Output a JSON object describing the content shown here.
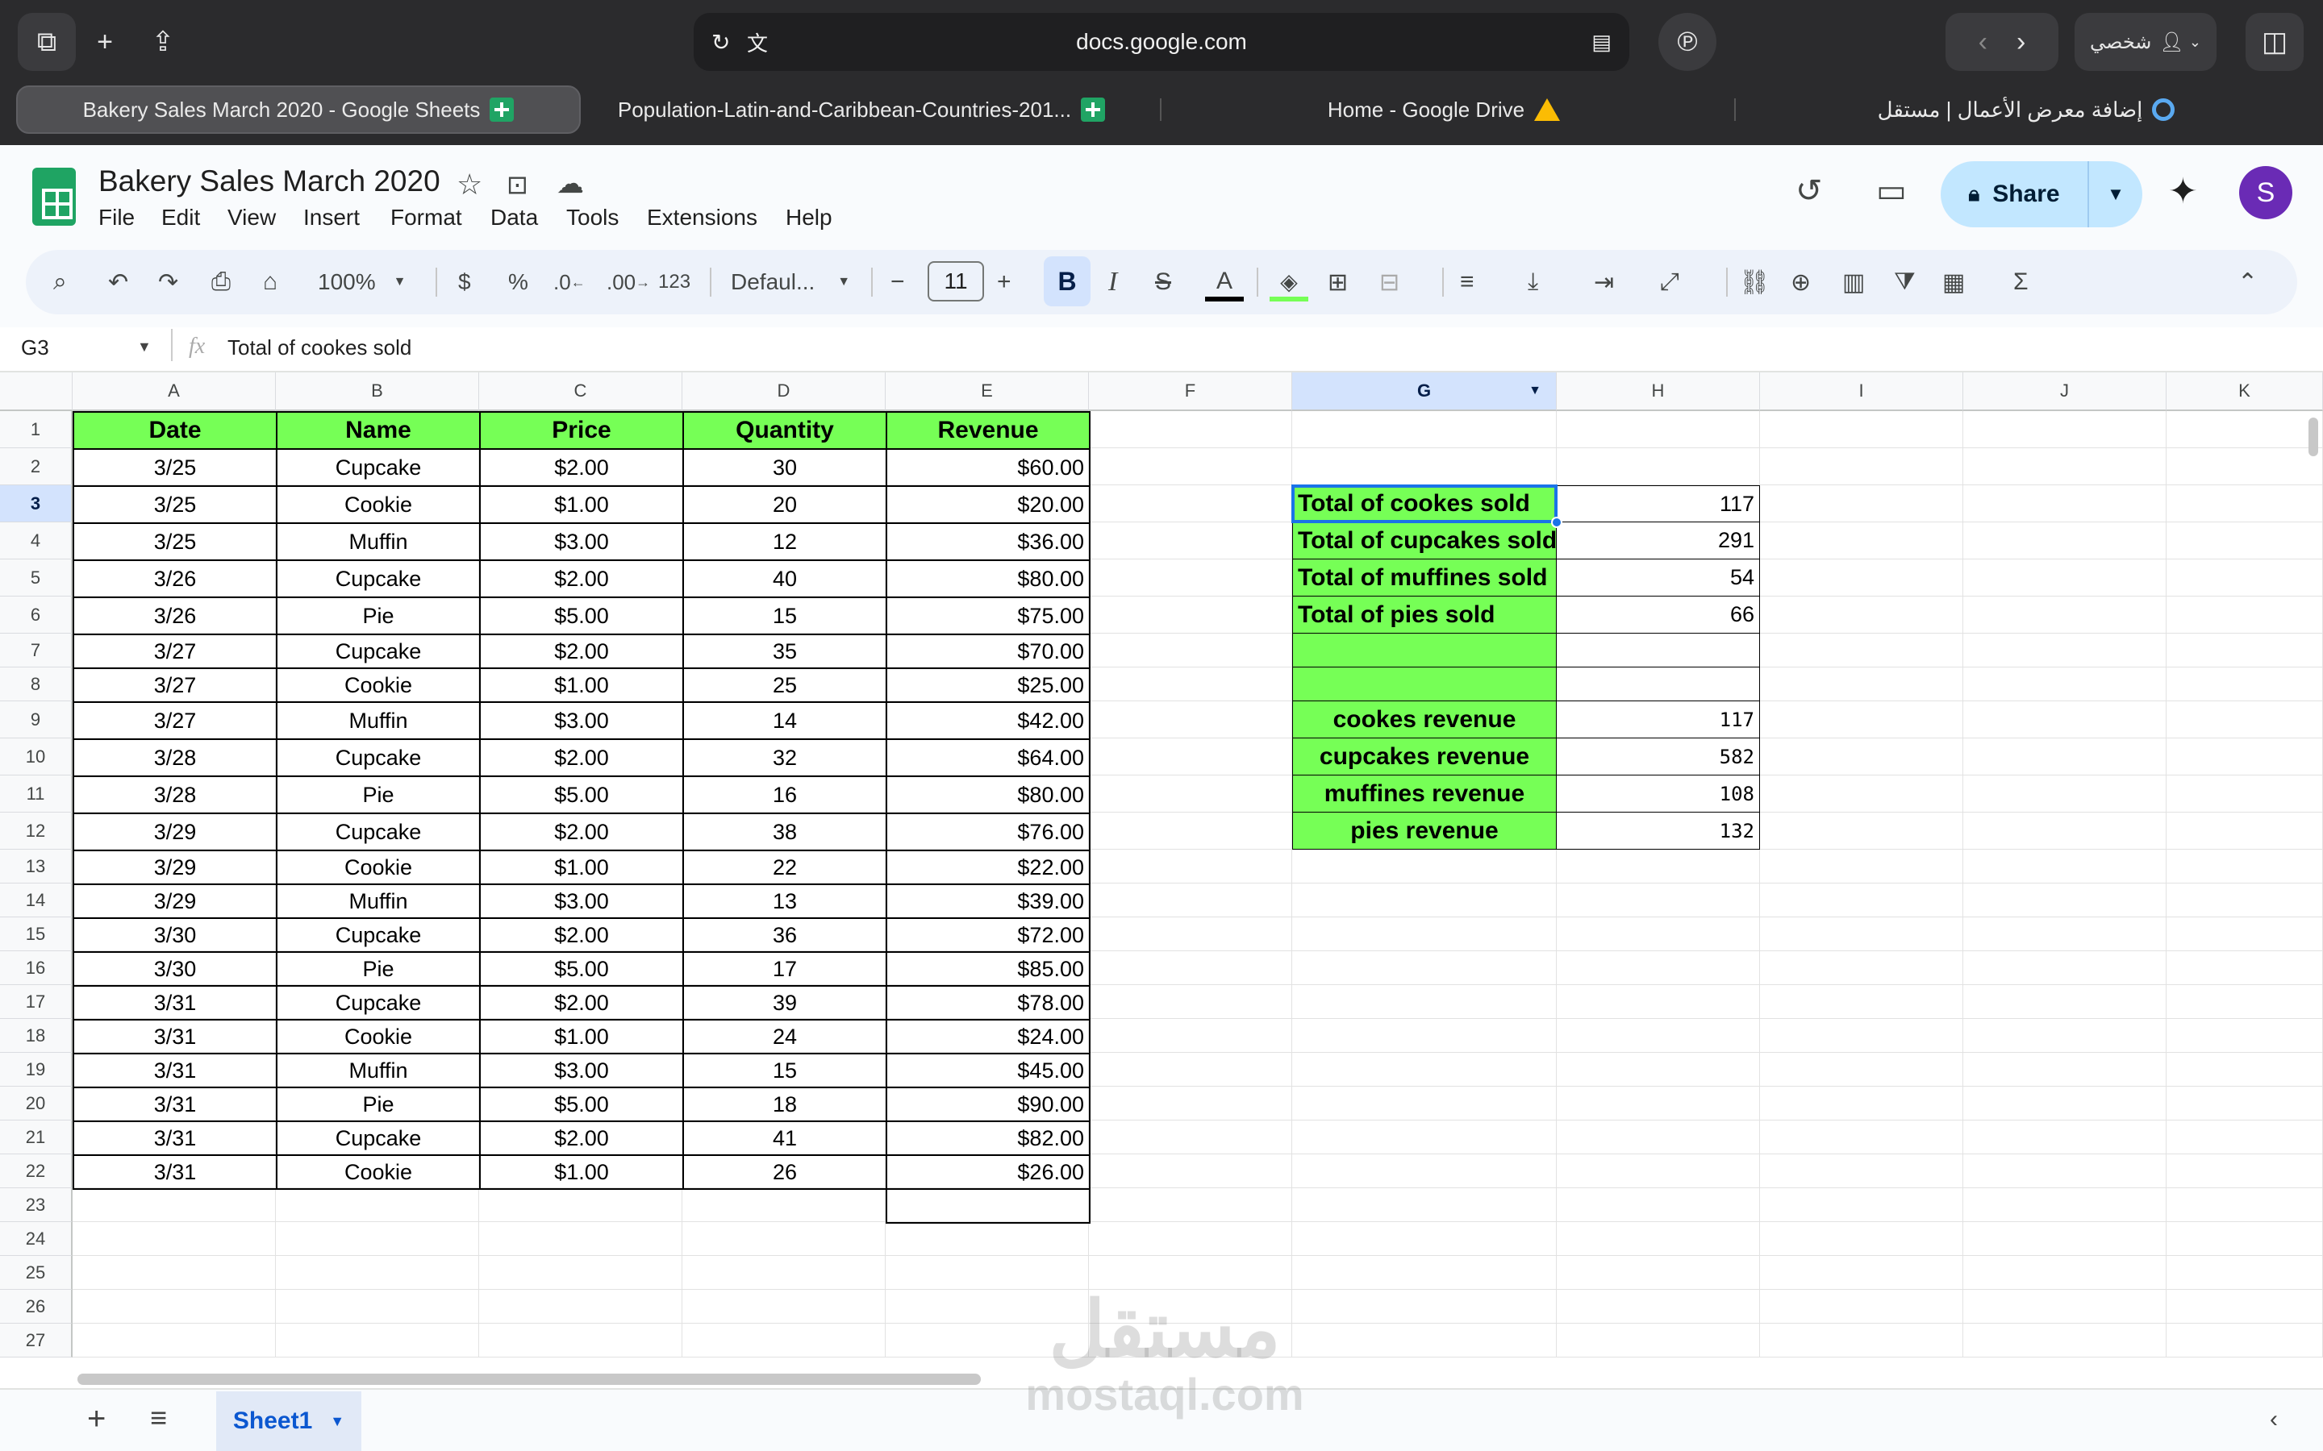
{
  "browser": {
    "url": "docs.google.com",
    "profile_label": "شخصي",
    "tabs": [
      {
        "label": "Bakery Sales March 2020 - Google Sheets",
        "icon": "sheets-icon"
      },
      {
        "label": "Population-Latin-and-Caribbean-Countries-201...",
        "icon": "sheets-icon"
      },
      {
        "label": "Home - Google Drive",
        "icon": "drive-icon"
      },
      {
        "label": "إضافة معرض الأعمال | مستقل",
        "icon": "globe-icon"
      }
    ]
  },
  "doc": {
    "title": "Bakery Sales March 2020",
    "menu": [
      "File",
      "Edit",
      "View",
      "Insert",
      "Format",
      "Data",
      "Tools",
      "Extensions",
      "Help"
    ],
    "share_label": "Share",
    "avatar_letter": "S"
  },
  "toolbar": {
    "zoom": "100%",
    "currency": "$",
    "percent": "%",
    "dec_decrease": ".0",
    "dec_increase": ".00",
    "number_format": "123",
    "font": "Defaul...",
    "font_size": "11",
    "bold": "B",
    "italic": "I",
    "text_color": "A"
  },
  "formula_bar": {
    "cell_ref": "G3",
    "fx": "fx",
    "content": "Total of cookes sold"
  },
  "columns": [
    "A",
    "B",
    "C",
    "D",
    "E",
    "F",
    "G",
    "H",
    "I",
    "J",
    "K"
  ],
  "rows": [
    "1",
    "2",
    "3",
    "4",
    "5",
    "6",
    "7",
    "8",
    "9",
    "10",
    "11",
    "12",
    "13",
    "14",
    "15",
    "16",
    "17",
    "18",
    "19",
    "20",
    "21",
    "22",
    "23",
    "24",
    "25",
    "26",
    "27"
  ],
  "table": {
    "headers": [
      "Date",
      "Name",
      "Price",
      "Quantity",
      "Revenue"
    ],
    "rows": [
      [
        "3/25",
        "Cupcake",
        "$2.00",
        "30",
        "$60.00"
      ],
      [
        "3/25",
        "Cookie",
        "$1.00",
        "20",
        "$20.00"
      ],
      [
        "3/25",
        "Muffin",
        "$3.00",
        "12",
        "$36.00"
      ],
      [
        "3/26",
        "Cupcake",
        "$2.00",
        "40",
        "$80.00"
      ],
      [
        "3/26",
        "Pie",
        "$5.00",
        "15",
        "$75.00"
      ],
      [
        "3/27",
        "Cupcake",
        "$2.00",
        "35",
        "$70.00"
      ],
      [
        "3/27",
        "Cookie",
        "$1.00",
        "25",
        "$25.00"
      ],
      [
        "3/27",
        "Muffin",
        "$3.00",
        "14",
        "$42.00"
      ],
      [
        "3/28",
        "Cupcake",
        "$2.00",
        "32",
        "$64.00"
      ],
      [
        "3/28",
        "Pie",
        "$5.00",
        "16",
        "$80.00"
      ],
      [
        "3/29",
        "Cupcake",
        "$2.00",
        "38",
        "$76.00"
      ],
      [
        "3/29",
        "Cookie",
        "$1.00",
        "22",
        "$22.00"
      ],
      [
        "3/29",
        "Muffin",
        "$3.00",
        "13",
        "$39.00"
      ],
      [
        "3/30",
        "Cupcake",
        "$2.00",
        "36",
        "$72.00"
      ],
      [
        "3/30",
        "Pie",
        "$5.00",
        "17",
        "$85.00"
      ],
      [
        "3/31",
        "Cupcake",
        "$2.00",
        "39",
        "$78.00"
      ],
      [
        "3/31",
        "Cookie",
        "$1.00",
        "24",
        "$24.00"
      ],
      [
        "3/31",
        "Muffin",
        "$3.00",
        "15",
        "$45.00"
      ],
      [
        "3/31",
        "Pie",
        "$5.00",
        "18",
        "$90.00"
      ],
      [
        "3/31",
        "Cupcake",
        "$2.00",
        "41",
        "$82.00"
      ],
      [
        "3/31",
        "Cookie",
        "$1.00",
        "26",
        "$26.00"
      ]
    ]
  },
  "summary": {
    "totals": [
      {
        "label": "Total of cookes sold",
        "value": "117"
      },
      {
        "label": "Total of cupcakes sold",
        "value": "291"
      },
      {
        "label": "Total of muffines sold",
        "value": "54"
      },
      {
        "label": "Total of pies sold",
        "value": "66"
      }
    ],
    "revenues": [
      {
        "label": "cookes revenue",
        "value": "117"
      },
      {
        "label": "cupcakes revenue",
        "value": "582"
      },
      {
        "label": "muffines revenue",
        "value": "108"
      },
      {
        "label": "pies revenue",
        "value": "132"
      }
    ]
  },
  "sheet_tab": "Sheet1",
  "watermark": {
    "arabic": "مستقل",
    "latin": "mostaql.com"
  },
  "colors": {
    "header_green": "#76ff56",
    "selection": "#d3e3fd",
    "share_bg": "#c2e7ff",
    "accent": "#0b57d0"
  }
}
